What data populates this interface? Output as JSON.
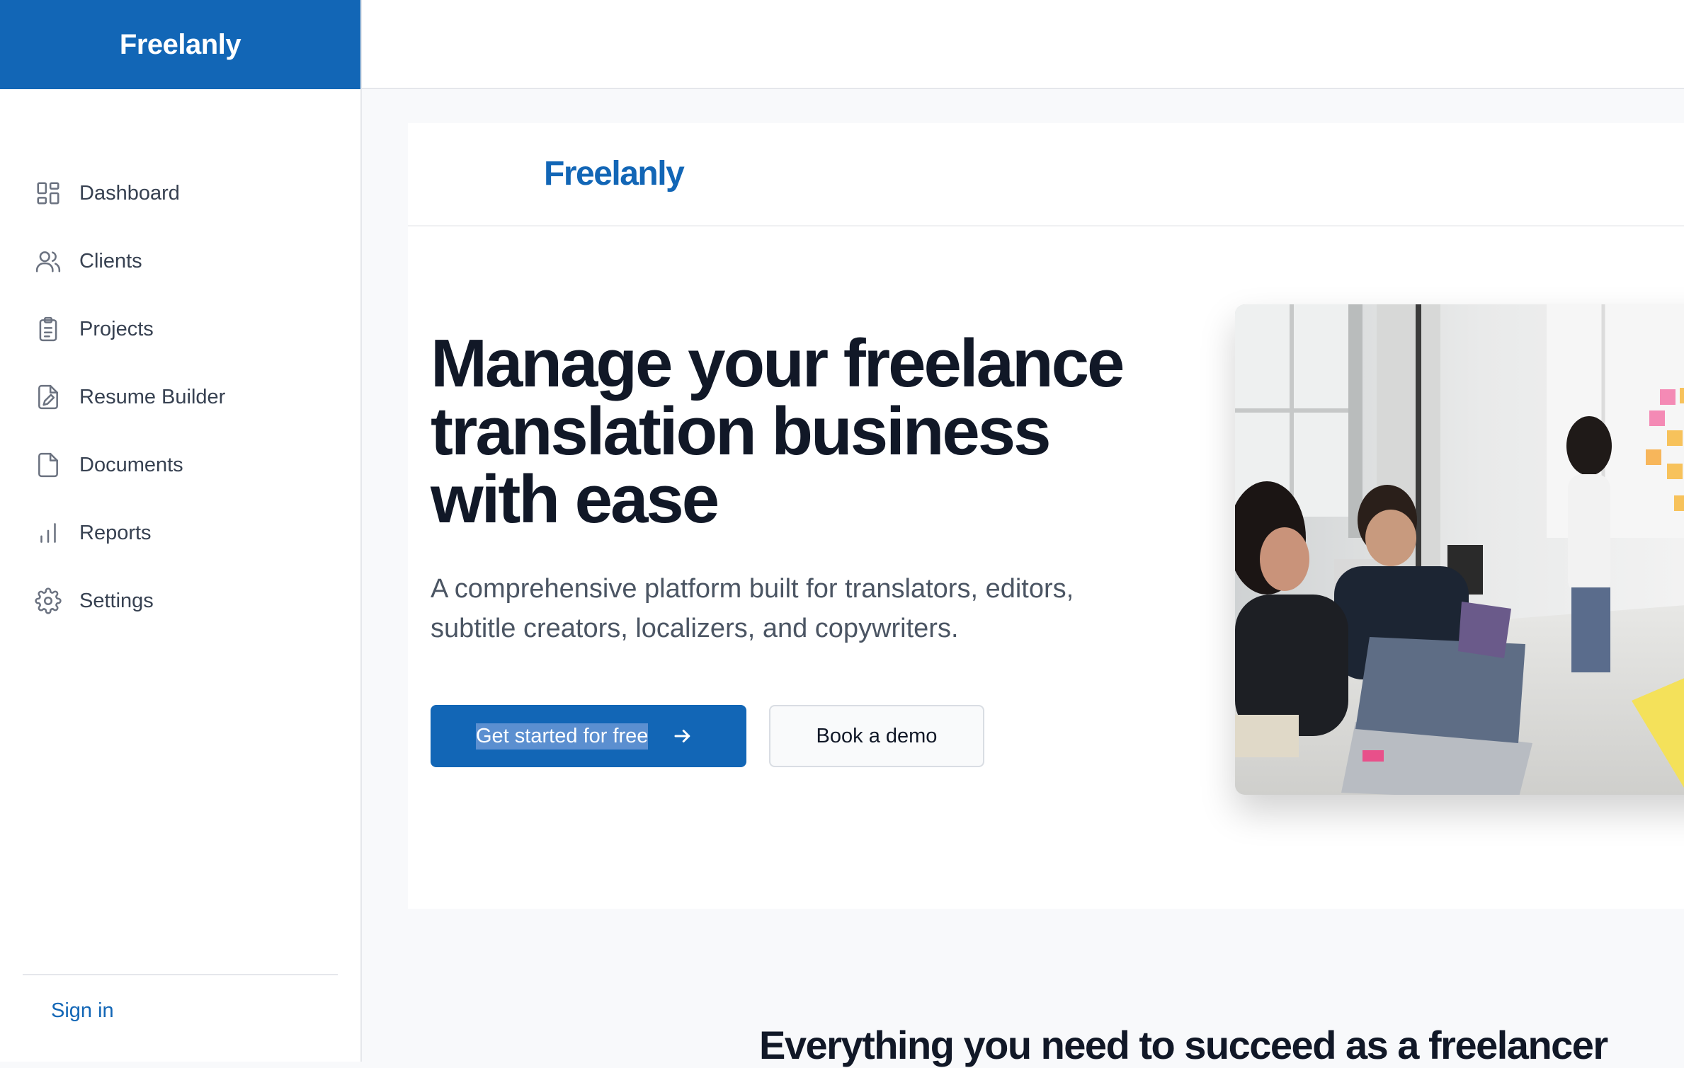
{
  "sidebar": {
    "brand": "Freelanly",
    "items": [
      {
        "label": "Dashboard",
        "icon": "dashboard-icon"
      },
      {
        "label": "Clients",
        "icon": "users-icon"
      },
      {
        "label": "Projects",
        "icon": "clipboard-icon"
      },
      {
        "label": "Resume Builder",
        "icon": "document-edit-icon"
      },
      {
        "label": "Documents",
        "icon": "document-icon"
      },
      {
        "label": "Reports",
        "icon": "bar-chart-icon"
      },
      {
        "label": "Settings",
        "icon": "gear-icon"
      }
    ],
    "sign_in": "Sign in"
  },
  "landing": {
    "logo": "Freelanly",
    "hero": {
      "title": "Manage your freelance translation business with ease",
      "subtitle": "A comprehensive platform built for translators, editors, subtitle creators, localizers, and copywriters.",
      "primary_cta": "Get started for free",
      "secondary_cta": "Book a demo"
    },
    "features_heading": "Everything you need to succeed as a freelancer"
  },
  "colors": {
    "brand": "#1266b6",
    "text_dark": "#111827",
    "text_muted": "#4b5563",
    "background": "#f8f9fb"
  }
}
